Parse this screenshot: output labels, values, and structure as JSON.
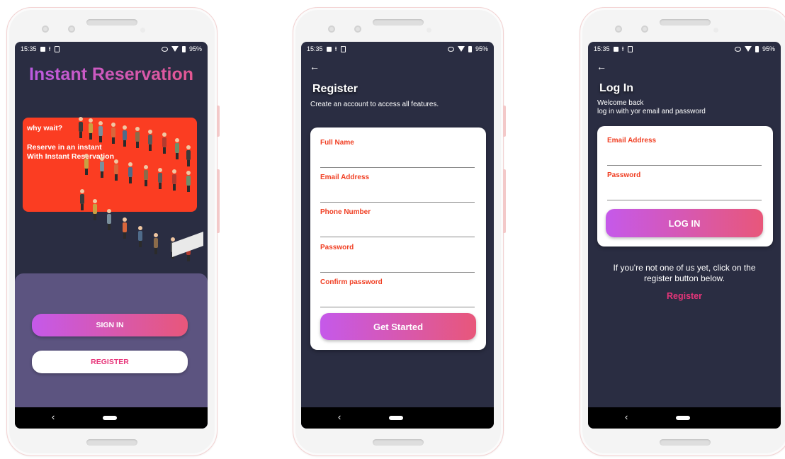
{
  "status_bar": {
    "time": "15:35",
    "battery": "95%"
  },
  "landing": {
    "title": "Instant Reservation",
    "hero_line1": "why wait?",
    "hero_line2": "Reserve in an instant",
    "hero_line3": "With Instant Reservation",
    "sign_in_label": "SIGN IN",
    "register_label": "REGISTER"
  },
  "register": {
    "title": "Register",
    "subtitle": "Create an account to access all features.",
    "fields": [
      {
        "label": "Full Name",
        "value": ""
      },
      {
        "label": "Email Address",
        "value": ""
      },
      {
        "label": "Phone Number",
        "value": ""
      },
      {
        "label": "Password",
        "value": ""
      },
      {
        "label": "Confirm password",
        "value": ""
      }
    ],
    "submit_label": "Get Started"
  },
  "login": {
    "title": "Log In",
    "subtitle_line1": "Welcome back",
    "subtitle_line2": "log in with yor email and password",
    "fields": [
      {
        "label": "Email Address",
        "value": ""
      },
      {
        "label": "Password",
        "value": ""
      }
    ],
    "submit_label": "LOG IN",
    "prompt": "If you're not one of us yet, click on the register button below.",
    "register_link": "Register"
  },
  "colors": {
    "screen_bg": "#2a2d42",
    "accent_gradient_start": "#c559ea",
    "accent_gradient_end": "#e8577a",
    "hero_card": "#fb3d22",
    "field_label": "#f03e22",
    "link": "#e8357a",
    "panel": "#5c5480"
  }
}
